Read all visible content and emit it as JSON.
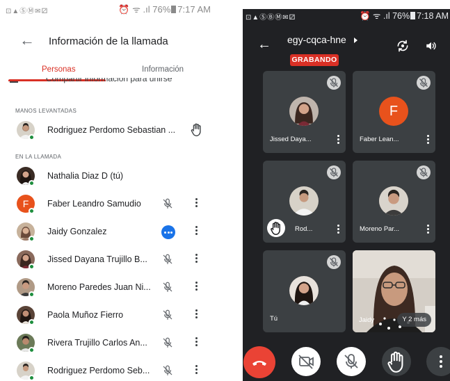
{
  "left_screen": {
    "status_bar": {
      "icons": "⊡▲ⓈⓂ✉⚂",
      "right": "⏰ ᯤ .ıl 76%",
      "time": "7:17 AM"
    },
    "title": "Información de la llamada",
    "tabs": [
      {
        "label": "Personas",
        "active": true
      },
      {
        "label": "Información",
        "active": false
      }
    ],
    "cut_row_text": "Compartir información para unirse",
    "sections": {
      "raised_hands": {
        "heading": "MANOS LEVANTADAS",
        "participants": [
          {
            "name": "Rodriguez Perdomo Sebastian ...",
            "avatar_color": "#d7d2c8",
            "status": "hand"
          }
        ]
      },
      "in_call": {
        "heading": "EN LA LLAMADA",
        "participants": [
          {
            "name": "Nathalia Diaz D (tú)",
            "avatar_color": "#3a2b24",
            "status": "none"
          },
          {
            "name": "Faber Leandro Samudio",
            "avatar_letter": "F",
            "avatar_color": "#e8521c",
            "status": "muted"
          },
          {
            "name": "Jaidy Gonzalez",
            "avatar_color": "#c7b29b",
            "status": "speaking"
          },
          {
            "name": "Jissed Dayana Trujillo B...",
            "avatar_color": "#8a6a5c",
            "status": "muted"
          },
          {
            "name": "Moreno Paredes Juan Ni...",
            "avatar_color": "#b09a86",
            "status": "muted"
          },
          {
            "name": "Paola Muñoz Fierro",
            "avatar_color": "#5a4337",
            "status": "muted"
          },
          {
            "name": "Rivera Trujillo Carlos An...",
            "avatar_color": "#6b7a58",
            "status": "muted"
          },
          {
            "name": "Rodriguez Perdomo Seb...",
            "avatar_color": "#d7d2c8",
            "status": "muted"
          }
        ]
      }
    }
  },
  "right_screen": {
    "status_bar": {
      "icons": "⊡▲ⓈⒷⓂ✉⚂",
      "right": "⏰ ᯤ .ıl 76%",
      "time": "7:18 AM"
    },
    "meeting_code": "egy-cqca-hne",
    "recording_label": "GRABANDO",
    "tiles": [
      {
        "name": "Jissed Daya...",
        "avatar_color": "#8a6a5c"
      },
      {
        "name": "Faber Lean...",
        "avatar_letter": "F",
        "avatar_color": "#e8521c"
      },
      {
        "name": "Rod...",
        "avatar_color": "#d7d2c8",
        "hand": true
      },
      {
        "name": "Moreno Par...",
        "avatar_color": "#b09a86"
      },
      {
        "name": "Tú",
        "avatar_color": "#3a2b24"
      },
      {
        "name": "Jaidy",
        "overlay": "Y 2 más"
      }
    ],
    "colors": {
      "end_call": "#ea4335",
      "recording": "#d93025",
      "speaking": "#1a73e8",
      "online": "#1e8e3e"
    }
  }
}
